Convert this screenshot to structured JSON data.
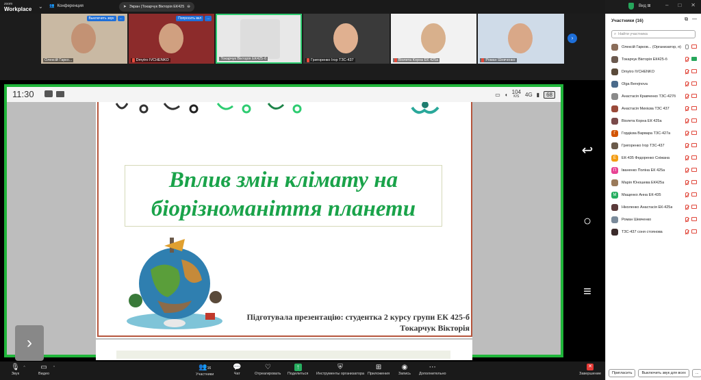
{
  "app": {
    "logo_line1": "zoom",
    "logo_line2": "Workplace",
    "conference_label": "Конференция",
    "share_label": "Экран (Токарчук Вікторія ЕК425",
    "view_label": "Вид"
  },
  "tiles": [
    {
      "name": "Олексій Гарко...",
      "buttons": [
        "Выключить звук",
        "..."
      ],
      "muted": false
    },
    {
      "name": "Dmytro IVCHENKO",
      "buttons": [
        "Попросить вкл",
        "..."
      ],
      "muted": true
    },
    {
      "name": "Токарчук Вікторія ЕК425-б",
      "buttons": [],
      "muted": false,
      "active": true
    },
    {
      "name": "Григоренко Ігор ТЗС-437",
      "buttons": [],
      "muted": true
    },
    {
      "name": "Віолета Корна ЕК 425а",
      "buttons": [],
      "muted": true
    },
    {
      "name": "Роман Шевченко",
      "buttons": [],
      "muted": true
    }
  ],
  "phone": {
    "time": "11:30",
    "speed": "104",
    "speed_unit": "K/S",
    "network": "4G",
    "battery": "68"
  },
  "slide": {
    "title_line1": "Вплив змін клімату на",
    "title_line2": "біорізноманіття планети",
    "prepared_line1": "Підготувала презентацію: студентка 2 курсу групи ЕК 425-б",
    "prepared_line2": "Токарчук Вікторія"
  },
  "panel": {
    "title": "Участники (16)",
    "search_placeholder": "Найти участника",
    "participants": [
      {
        "name": "Олексій Гарков...  (Организатор, я)",
        "avatar": "photo",
        "color": "#8a6d5a",
        "mic": "on",
        "cam": "off"
      },
      {
        "name": "Токарчук Вікторія ЕК425-б",
        "avatar": "photo",
        "color": "#6b5a4f",
        "mic": "off",
        "cam": "on"
      },
      {
        "name": "Dmytro IVCHENKO",
        "avatar": "photo",
        "color": "#5a4a3a",
        "mic": "off",
        "cam": "off"
      },
      {
        "name": "Olga Berejnova",
        "avatar": "photo",
        "color": "#4a6a8a",
        "mic": "off",
        "cam": "off"
      },
      {
        "name": "Анастасія Кравченко ТЗС-427б",
        "avatar": "photo",
        "color": "#8a8a8a",
        "mic": "off",
        "cam": "off"
      },
      {
        "name": "Анастасія Михієва ТЗС 437",
        "avatar": "photo",
        "color": "#9a4a3a",
        "mic": "off",
        "cam": "off"
      },
      {
        "name": "Віолета Корна ЕК 425а",
        "avatar": "photo",
        "color": "#7a4a4a",
        "mic": "off",
        "cam": "off"
      },
      {
        "name": "Гордієва Варвара ТЗС-427а",
        "avatar": "Г",
        "color": "#d35400",
        "mic": "off",
        "cam": "off"
      },
      {
        "name": "Григоренко Ігор ТЗС-437",
        "avatar": "photo",
        "color": "#6a5a4a",
        "mic": "off",
        "cam": "off"
      },
      {
        "name": "ЕК-435 Федоренко Сніжана",
        "avatar": "Е",
        "color": "#f39c12",
        "mic": "off",
        "cam": "off"
      },
      {
        "name": "Іваненко Поліна ЕК 425а",
        "avatar": "П",
        "color": "#e84393",
        "mic": "off",
        "cam": "off"
      },
      {
        "name": "Марія Юношева ЕК425а",
        "avatar": "photo",
        "color": "#9a7a5a",
        "mic": "off",
        "cam": "off"
      },
      {
        "name": "Мащенко Анна ЕК-435",
        "avatar": "М",
        "color": "#27ae60",
        "mic": "off",
        "cam": "off"
      },
      {
        "name": "Ніколенко Анастасія ЕК-425а",
        "avatar": "photo",
        "color": "#5a3a3a",
        "mic": "off",
        "cam": "off"
      },
      {
        "name": "Роман Шевченко",
        "avatar": "photo",
        "color": "#7a8a9a",
        "mic": "off",
        "cam": "off"
      },
      {
        "name": "ТЗС-437 соня стоянова",
        "avatar": "photo",
        "color": "#3a2a2a",
        "mic": "off",
        "cam": "off"
      }
    ],
    "invite_label": "Пригласить",
    "mute_all_label": "Выключить звук для всех",
    "more_label": "..."
  },
  "toolbar": {
    "audio": "Звук",
    "video": "Видео",
    "participants": "Участники",
    "participants_count": "16",
    "chat": "Чат",
    "react": "Отреагировать",
    "share": "Поделиться",
    "host_tools": "Инструменты организатора",
    "apps": "Приложения",
    "record": "Запись",
    "more": "Дополнительно",
    "end": "Завершение"
  }
}
